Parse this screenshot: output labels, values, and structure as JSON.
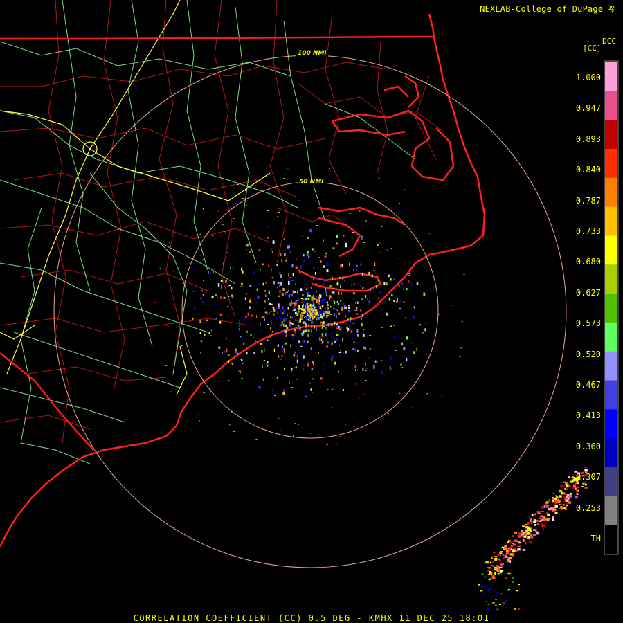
{
  "header": {
    "credit": "NEXLAB-College of DuPage",
    "product_code": "DCC",
    "units": "[CC]"
  },
  "map": {
    "ring_labels": [
      "100 NMI",
      "50 NMI"
    ],
    "colors": {
      "background": "#000000",
      "state_borders": "#ff1a1a",
      "county_borders": "#b01818",
      "highways": "#7fdc7f",
      "interstates": "#ffff40",
      "range_rings": "#e8a890",
      "coastline": "#ff2020"
    }
  },
  "color_scale": {
    "labels": [
      "1.000",
      "0.947",
      "0.893",
      "0.840",
      "0.787",
      "0.733",
      "0.680",
      "0.627",
      "0.573",
      "0.520",
      "0.467",
      "0.413",
      "0.360",
      "0.307",
      "0.253",
      "TH"
    ],
    "colors": [
      "#ff9ed8",
      "#e8508a",
      "#c00000",
      "#ff3000",
      "#ff8000",
      "#ffc000",
      "#ffff00",
      "#a8d000",
      "#50c000",
      "#60ff60",
      "#9090ff",
      "#4040e0",
      "#0000ff",
      "#0000c0",
      "#404080",
      "#808080",
      "#000000"
    ]
  },
  "footer": {
    "caption": "CORRELATION COEFFICIENT (CC) 0.5 DEG - KMHX 11 DEC 25 18:01"
  }
}
